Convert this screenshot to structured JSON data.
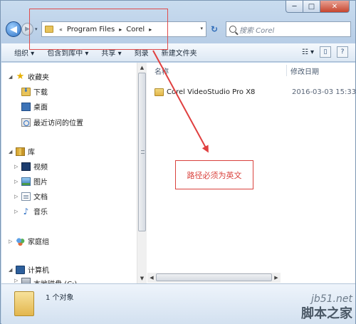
{
  "window": {
    "caption_buttons": [
      {
        "name": "minimize",
        "glyph": "─"
      },
      {
        "name": "maximize",
        "glyph": "□"
      },
      {
        "name": "close",
        "glyph": "✕"
      }
    ]
  },
  "nav": {
    "back_glyph": "◀",
    "forward_glyph": "▶",
    "dropdown_glyph": "▾"
  },
  "address": {
    "prefix": "«",
    "segments": [
      "Program Files",
      "Corel"
    ],
    "separator": "▸",
    "dropdown_glyph": "▾"
  },
  "refresh_glyph": "↻",
  "search": {
    "placeholder": "搜索 Corel"
  },
  "toolbar": {
    "items": [
      "组织 ▾",
      "包含到库中 ▾",
      "共享 ▾",
      "刻录",
      "新建文件夹"
    ],
    "view_glyph": "☷ ▾",
    "pane_glyph": "▯",
    "help_glyph": "?"
  },
  "sidebar": {
    "favorites": {
      "label": "收藏夹",
      "items": [
        "下载",
        "桌面",
        "最近访问的位置"
      ]
    },
    "libraries": {
      "label": "库",
      "items": [
        "视频",
        "图片",
        "文档",
        "音乐"
      ]
    },
    "homegroup": {
      "label": "家庭组"
    },
    "computer": {
      "label": "计算机",
      "items": [
        "本地磁盘 (C:)"
      ]
    }
  },
  "files": {
    "headers": {
      "name": "名称",
      "date": "修改日期"
    },
    "rows": [
      {
        "name": "Corel VideoStudio Pro X8",
        "date": "2016-03-03 15:33"
      }
    ]
  },
  "status": {
    "text": "1 个对象"
  },
  "annotation": {
    "note": "路径必须为英文",
    "color": "#d9423d"
  },
  "watermark": {
    "url": "jb51.net",
    "name": "脚本之家"
  }
}
